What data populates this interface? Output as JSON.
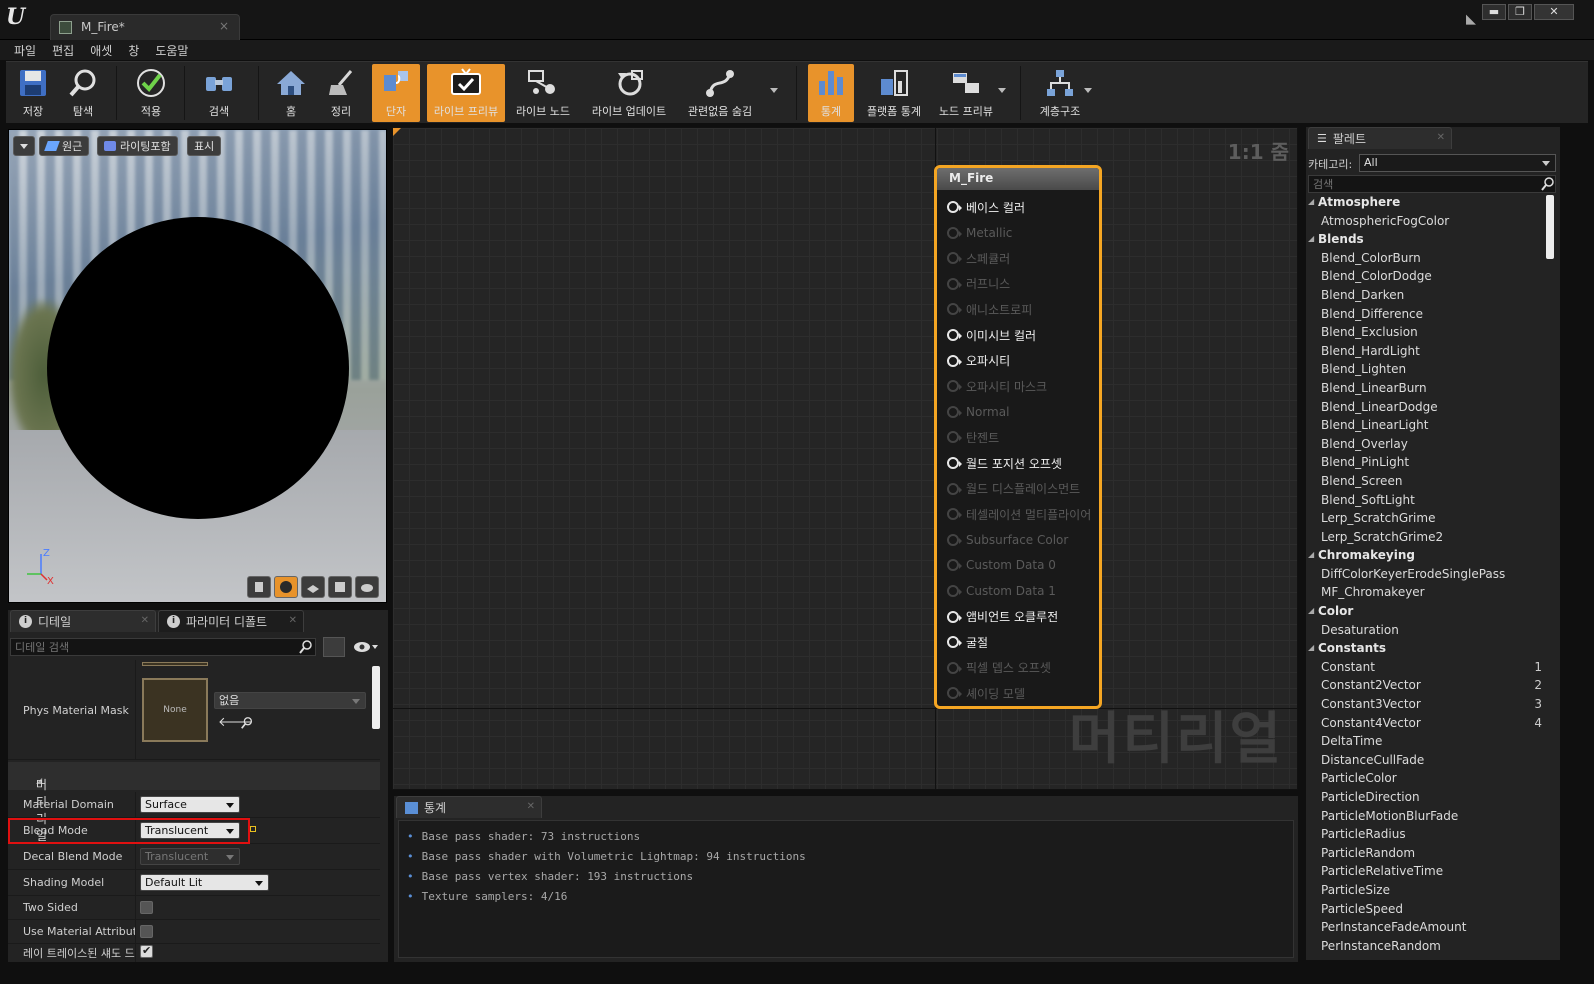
{
  "window": {
    "tab_title": "M_Fire*",
    "close_glyph": "×",
    "controls": [
      "▬",
      "❐",
      "✕"
    ]
  },
  "menu": [
    "파일",
    "편집",
    "애셋",
    "창",
    "도움말"
  ],
  "toolbar": [
    {
      "label": "저장",
      "icon": "save-icon",
      "active": false
    },
    {
      "label": "탐색",
      "icon": "browse-icon",
      "active": false
    },
    {
      "label": "적용",
      "icon": "apply-icon",
      "active": false
    },
    {
      "label": "검색",
      "icon": "search-icon",
      "active": false
    },
    {
      "label": "홈",
      "icon": "home-icon",
      "active": false
    },
    {
      "label": "정리",
      "icon": "clean-up-icon",
      "active": false
    },
    {
      "label": "단자",
      "icon": "connectors-icon",
      "active": true
    },
    {
      "label": "라이브 프리뷰",
      "icon": "live-preview-icon",
      "active": true
    },
    {
      "label": "라이브 노드",
      "icon": "live-nodes-icon",
      "active": false
    },
    {
      "label": "라이브 업데이트",
      "icon": "live-update-icon",
      "active": false
    },
    {
      "label": "관련없음 숨김",
      "icon": "hide-unrelated-icon",
      "active": false
    },
    {
      "label": "통계",
      "icon": "stats-icon",
      "active": true
    },
    {
      "label": "플랫폼 통계",
      "icon": "platform-stats-icon",
      "active": false
    },
    {
      "label": "노드 프리뷰",
      "icon": "node-preview-icon",
      "active": false
    },
    {
      "label": "계층구조",
      "icon": "hierarchy-icon",
      "active": false
    }
  ],
  "viewport": {
    "view_mode": "원근",
    "lighting": "라이팅포함",
    "show": "표시",
    "axis_z": "Z",
    "axis_x": "X"
  },
  "details": {
    "tab_details": "디테일",
    "tab_param_defaults": "파라미터 디폴트",
    "search_placeholder": "디테일 검색",
    "phys_material_mask_label": "Phys Material Mask",
    "phys_material_thumb": "None",
    "phys_material_value": "없음",
    "section_title": "머티리얼",
    "material_domain_label": "Material Domain",
    "material_domain_value": "Surface",
    "blend_mode_label": "Blend Mode",
    "blend_mode_value": "Translucent",
    "decal_blend_mode_label": "Decal Blend Mode",
    "decal_blend_mode_value": "Translucent",
    "shading_model_label": "Shading Model",
    "shading_model_value": "Default Lit",
    "two_sided_label": "Two Sided",
    "two_sided_checked": false,
    "use_material_attributes_label": "Use Material Attributes",
    "use_material_attributes_checked": false,
    "ray_traced_shadows_label": "레이 트레이스된 섀도 드리우기",
    "ray_traced_shadows_checked": true
  },
  "graph": {
    "zoom": "1:1 줌",
    "watermark": "머티리얼",
    "node_title": "M_Fire",
    "pins": [
      {
        "label": "베이스 컬러",
        "active": true
      },
      {
        "label": "Metallic",
        "active": false
      },
      {
        "label": "스페큘러",
        "active": false
      },
      {
        "label": "러프니스",
        "active": false
      },
      {
        "label": "애니소트로피",
        "active": false
      },
      {
        "label": "이미시브 컬러",
        "active": true
      },
      {
        "label": "오파시티",
        "active": true
      },
      {
        "label": "오파시티 마스크",
        "active": false
      },
      {
        "label": "Normal",
        "active": false
      },
      {
        "label": "탄젠트",
        "active": false
      },
      {
        "label": "월드 포지션 오프셋",
        "active": true
      },
      {
        "label": "월드 디스플레이스먼트",
        "active": false
      },
      {
        "label": "테셀레이션 멀티플라이어",
        "active": false
      },
      {
        "label": "Subsurface Color",
        "active": false
      },
      {
        "label": "Custom Data 0",
        "active": false
      },
      {
        "label": "Custom Data 1",
        "active": false
      },
      {
        "label": "앰비언트 오클루전",
        "active": true
      },
      {
        "label": "굴절",
        "active": true
      },
      {
        "label": "픽셀 뎁스 오프셋",
        "active": false
      },
      {
        "label": "셰이딩 모델",
        "active": false
      }
    ]
  },
  "stats": {
    "tab": "통계",
    "lines": [
      "Base pass shader: 73 instructions",
      "Base pass shader with Volumetric Lightmap: 94 instructions",
      "Base pass vertex shader: 193 instructions",
      "Texture samplers: 4/16"
    ]
  },
  "palette": {
    "tab": "팔레트",
    "category_label": "카테고리:",
    "category_value": "All",
    "search_placeholder": "검색",
    "items": [
      {
        "type": "cat",
        "label": "Atmosphere",
        "hotkey": ""
      },
      {
        "type": "leaf",
        "label": "AtmosphericFogColor",
        "hotkey": ""
      },
      {
        "type": "cat",
        "label": "Blends",
        "hotkey": ""
      },
      {
        "type": "leaf",
        "label": "Blend_ColorBurn",
        "hotkey": ""
      },
      {
        "type": "leaf",
        "label": "Blend_ColorDodge",
        "hotkey": ""
      },
      {
        "type": "leaf",
        "label": "Blend_Darken",
        "hotkey": ""
      },
      {
        "type": "leaf",
        "label": "Blend_Difference",
        "hotkey": ""
      },
      {
        "type": "leaf",
        "label": "Blend_Exclusion",
        "hotkey": ""
      },
      {
        "type": "leaf",
        "label": "Blend_HardLight",
        "hotkey": ""
      },
      {
        "type": "leaf",
        "label": "Blend_Lighten",
        "hotkey": ""
      },
      {
        "type": "leaf",
        "label": "Blend_LinearBurn",
        "hotkey": ""
      },
      {
        "type": "leaf",
        "label": "Blend_LinearDodge",
        "hotkey": ""
      },
      {
        "type": "leaf",
        "label": "Blend_LinearLight",
        "hotkey": ""
      },
      {
        "type": "leaf",
        "label": "Blend_Overlay",
        "hotkey": ""
      },
      {
        "type": "leaf",
        "label": "Blend_PinLight",
        "hotkey": ""
      },
      {
        "type": "leaf",
        "label": "Blend_Screen",
        "hotkey": ""
      },
      {
        "type": "leaf",
        "label": "Blend_SoftLight",
        "hotkey": ""
      },
      {
        "type": "leaf",
        "label": "Lerp_ScratchGrime",
        "hotkey": ""
      },
      {
        "type": "leaf",
        "label": "Lerp_ScratchGrime2",
        "hotkey": ""
      },
      {
        "type": "cat",
        "label": "Chromakeying",
        "hotkey": ""
      },
      {
        "type": "leaf",
        "label": "DiffColorKeyerErodeSinglePass",
        "hotkey": ""
      },
      {
        "type": "leaf",
        "label": "MF_Chromakeyer",
        "hotkey": ""
      },
      {
        "type": "cat",
        "label": "Color",
        "hotkey": ""
      },
      {
        "type": "leaf",
        "label": "Desaturation",
        "hotkey": ""
      },
      {
        "type": "cat",
        "label": "Constants",
        "hotkey": ""
      },
      {
        "type": "leaf",
        "label": "Constant",
        "hotkey": "1"
      },
      {
        "type": "leaf",
        "label": "Constant2Vector",
        "hotkey": "2"
      },
      {
        "type": "leaf",
        "label": "Constant3Vector",
        "hotkey": "3"
      },
      {
        "type": "leaf",
        "label": "Constant4Vector",
        "hotkey": "4"
      },
      {
        "type": "leaf",
        "label": "DeltaTime",
        "hotkey": ""
      },
      {
        "type": "leaf",
        "label": "DistanceCullFade",
        "hotkey": ""
      },
      {
        "type": "leaf",
        "label": "ParticleColor",
        "hotkey": ""
      },
      {
        "type": "leaf",
        "label": "ParticleDirection",
        "hotkey": ""
      },
      {
        "type": "leaf",
        "label": "ParticleMotionBlurFade",
        "hotkey": ""
      },
      {
        "type": "leaf",
        "label": "ParticleRadius",
        "hotkey": ""
      },
      {
        "type": "leaf",
        "label": "ParticleRandom",
        "hotkey": ""
      },
      {
        "type": "leaf",
        "label": "ParticleRelativeTime",
        "hotkey": ""
      },
      {
        "type": "leaf",
        "label": "ParticleSize",
        "hotkey": ""
      },
      {
        "type": "leaf",
        "label": "ParticleSpeed",
        "hotkey": ""
      },
      {
        "type": "leaf",
        "label": "PerInstanceFadeAmount",
        "hotkey": ""
      },
      {
        "type": "leaf",
        "label": "PerInstanceRandom",
        "hotkey": ""
      }
    ]
  },
  "colors": {
    "accent": "#e8932b",
    "node_border": "#f5a623",
    "highlight": "#e01010",
    "background": "#232323"
  }
}
